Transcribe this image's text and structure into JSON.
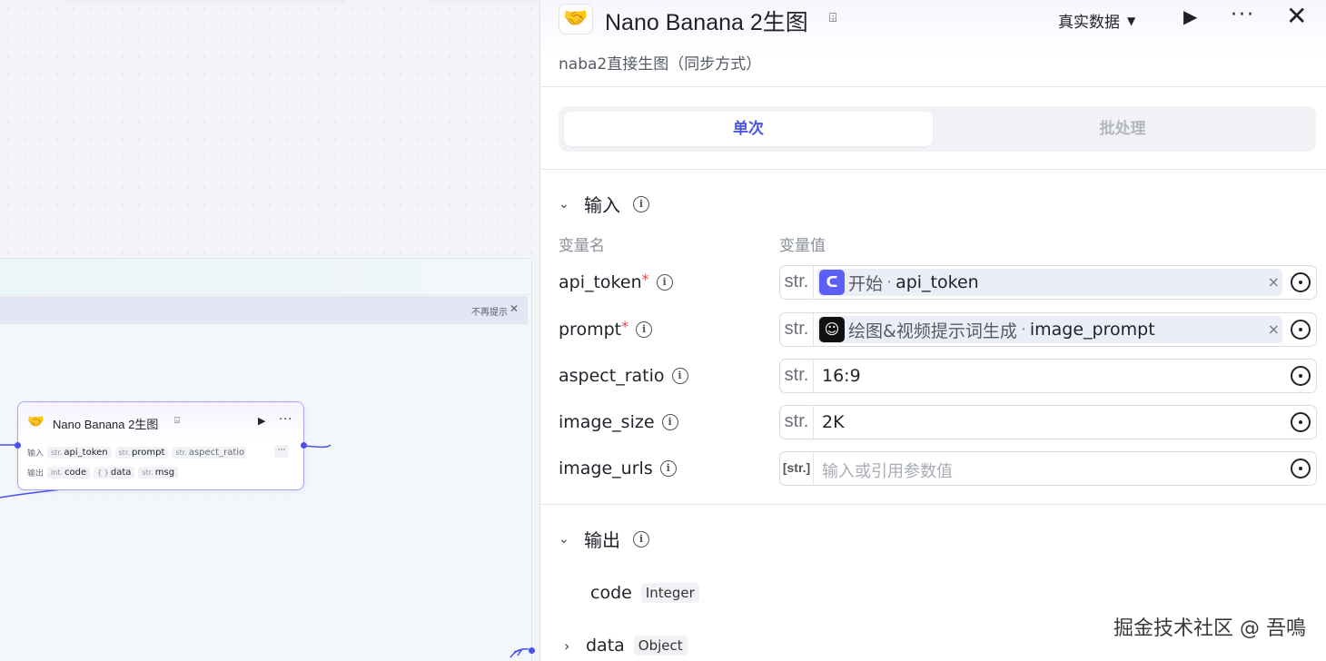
{
  "canvas": {
    "hint_dismiss": "不再提示",
    "hint_close": "✕",
    "node": {
      "title": "Nano Banana 2生图",
      "run": "▶",
      "more": "···",
      "input_label": "输入",
      "output_label": "输出",
      "inputs": [
        {
          "type": "str.",
          "name": "api_token"
        },
        {
          "type": "str.",
          "name": "prompt"
        },
        {
          "type": "str.",
          "name": "aspect_ratio"
        }
      ],
      "inputs_more": "···",
      "outputs": [
        {
          "type": "int.",
          "name": "code"
        },
        {
          "type": "{ }",
          "name": "data"
        },
        {
          "type": "str.",
          "name": "msg"
        }
      ]
    }
  },
  "panel": {
    "title": "Nano Banana 2生图",
    "subtitle": "naba2直接生图（同步方式）",
    "data_mode": "真实数据",
    "tabs": {
      "single": "单次",
      "batch": "批处理"
    },
    "input_section": {
      "title": "输入",
      "col_name": "变量名",
      "col_value": "变量值",
      "rows": [
        {
          "name": "api_token",
          "required": "*",
          "type": "str.",
          "ref_source": "开始",
          "ref_var": "api_token"
        },
        {
          "name": "prompt",
          "required": "*",
          "type": "str.",
          "ref_source": "绘图&视频提示词生成",
          "ref_var": "image_prompt"
        },
        {
          "name": "aspect_ratio",
          "type": "str.",
          "value": "16:9"
        },
        {
          "name": "image_size",
          "type": "str.",
          "value": "2K"
        },
        {
          "name": "image_urls",
          "type": "[str.]",
          "placeholder": "输入或引用参数值"
        }
      ],
      "ref_dot": "·",
      "ref_clear": "×"
    },
    "output_section": {
      "title": "输出",
      "rows": [
        {
          "name": "code",
          "type": "Integer"
        },
        {
          "name": "data",
          "type": "Object"
        }
      ]
    },
    "watermark": "掘金技术社区 @ 吾鳴"
  },
  "colors": {
    "accent": "#4d53e8",
    "required": "#e04848",
    "node_border": "#a7a6f2"
  }
}
